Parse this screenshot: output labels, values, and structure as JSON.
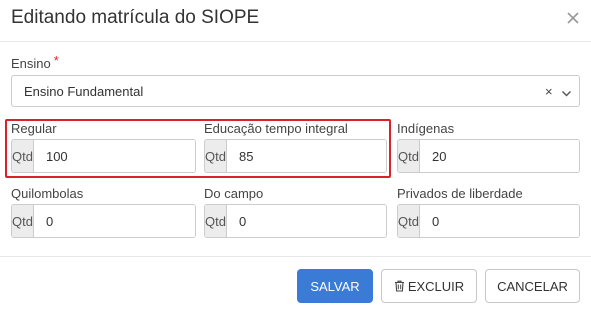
{
  "modal": {
    "title": "Editando matrícula do SIOPE",
    "close_icon": "close-icon"
  },
  "ensino": {
    "label": "Ensino",
    "required_mark": "*",
    "value": "Ensino Fundamental",
    "clear_symbol": "×",
    "chevron_icon": "chevron-down-icon"
  },
  "fields": [
    {
      "label": "Regular",
      "addon": "Qtd",
      "value": "100"
    },
    {
      "label": "Educação tempo integral",
      "addon": "Qtd",
      "value": "85"
    },
    {
      "label": "Indígenas",
      "addon": "Qtd",
      "value": "20"
    },
    {
      "label": "Quilombolas",
      "addon": "Qtd",
      "value": "0"
    },
    {
      "label": "Do campo",
      "addon": "Qtd",
      "value": "0"
    },
    {
      "label": "Privados de liberdade",
      "addon": "Qtd",
      "value": "0"
    }
  ],
  "highlight_color": "#d9222a",
  "actions": {
    "save_label": "SALVAR",
    "delete_label": "EXCLUIR",
    "delete_icon": "trash-icon",
    "cancel_label": "CANCELAR",
    "primary_color": "#3a7bd5"
  }
}
